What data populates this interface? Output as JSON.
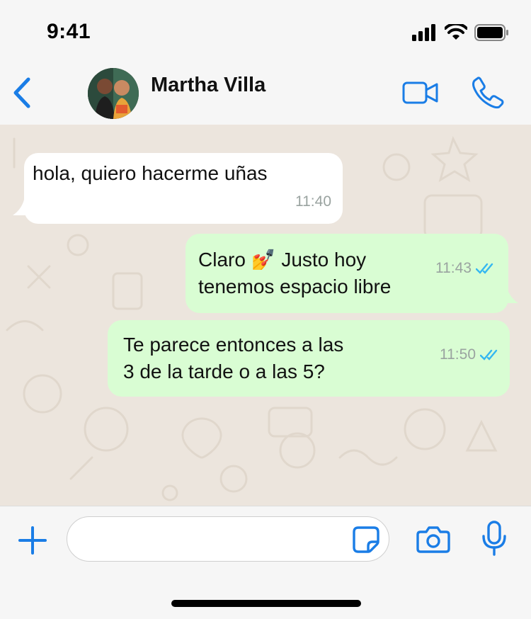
{
  "status_bar": {
    "time": "9:41"
  },
  "header": {
    "contact_name": "Martha Villa",
    "back_icon": "chevron-left-icon",
    "video_icon": "video-camera-icon",
    "phone_icon": "phone-icon"
  },
  "messages": [
    {
      "direction": "incoming",
      "text": "hola, quiero hacerme uñas",
      "time": "11:40"
    },
    {
      "direction": "outgoing",
      "text": "Claro 💅 Justo hoy\ntenemos espacio libre",
      "time": "11:43",
      "status": "read"
    },
    {
      "direction": "outgoing",
      "text": "Te parece entonces a las\n3 de la tarde o a las 5?",
      "time": "11:50",
      "status": "read"
    }
  ],
  "input_bar": {
    "value": "",
    "plus_icon": "plus-icon",
    "sticker_icon": "sticker-icon",
    "camera_icon": "camera-icon",
    "mic_icon": "microphone-icon"
  },
  "colors": {
    "accent": "#1a7de6",
    "incoming_bubble": "#ffffff",
    "outgoing_bubble": "#d9fdd3",
    "chat_background": "#ece5dd",
    "read_ticks": "#34b7f1"
  }
}
